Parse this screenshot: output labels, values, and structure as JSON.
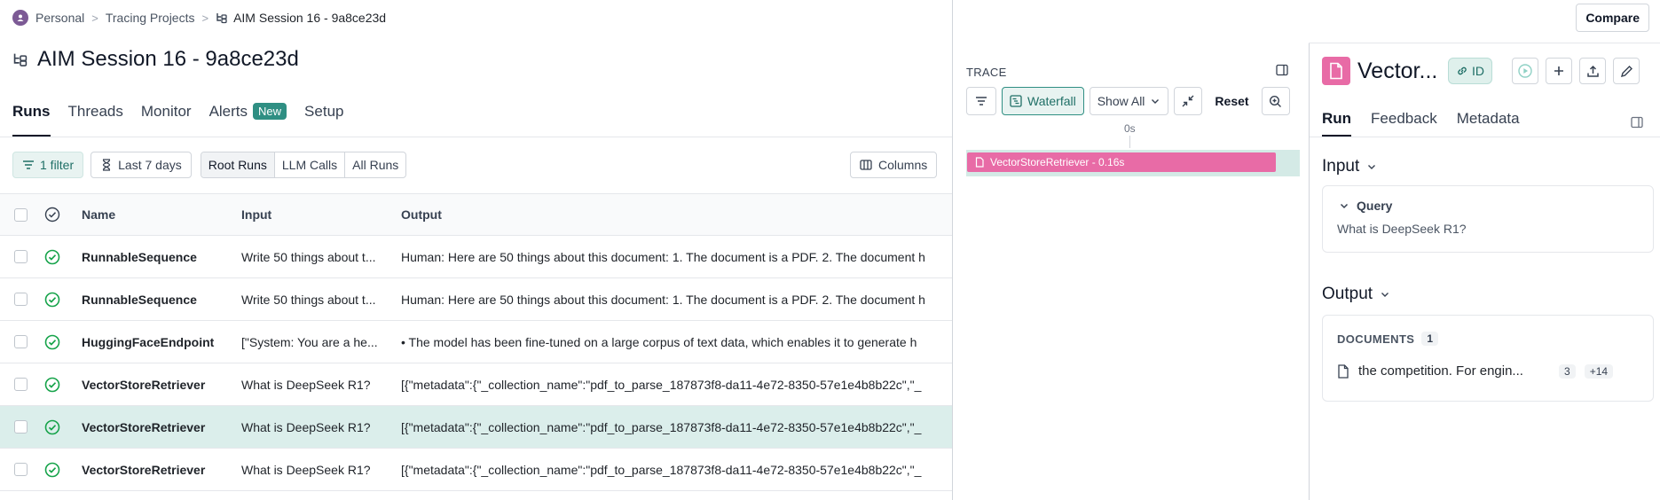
{
  "breadcrumb": {
    "workspace": "Personal",
    "projects": "Tracing Projects",
    "session": "AIM Session 16 - 9a8ce23d"
  },
  "page": {
    "title": "AIM Session 16 - 9a8ce23d"
  },
  "tabs": [
    {
      "label": "Runs"
    },
    {
      "label": "Threads"
    },
    {
      "label": "Monitor"
    },
    {
      "label": "Alerts",
      "badge": "New"
    },
    {
      "label": "Setup"
    }
  ],
  "filters": {
    "filter_label": "1 filter",
    "date_label": "Last 7 days",
    "run_types": [
      "Root Runs",
      "LLM Calls",
      "All Runs"
    ],
    "columns_label": "Columns"
  },
  "table": {
    "headers": {
      "name": "Name",
      "input": "Input",
      "output": "Output"
    },
    "rows": [
      {
        "name": "RunnableSequence",
        "input": "Write 50 things about t...",
        "output": "Human: Here are 50 things about this document: 1. The document is a PDF. 2. The document h"
      },
      {
        "name": "RunnableSequence",
        "input": "Write 50 things about t...",
        "output": "Human: Here are 50 things about this document: 1. The document is a PDF. 2. The document h"
      },
      {
        "name": "HuggingFaceEndpoint",
        "input": "[\"System: You are a he...",
        "output": "• The model has been fine-tuned on a large corpus of text data, which enables it to generate h"
      },
      {
        "name": "VectorStoreRetriever",
        "input": "What is DeepSeek R1?",
        "output": "[{\"metadata\":{\"_collection_name\":\"pdf_to_parse_187873f8-da11-4e72-8350-57e1e4b8b22c\",\"_"
      },
      {
        "name": "VectorStoreRetriever",
        "input": "What is DeepSeek R1?",
        "output": "[{\"metadata\":{\"_collection_name\":\"pdf_to_parse_187873f8-da11-4e72-8350-57e1e4b8b22c\",\"_"
      },
      {
        "name": "VectorStoreRetriever",
        "input": "What is DeepSeek R1?",
        "output": "[{\"metadata\":{\"_collection_name\":\"pdf_to_parse_187873f8-da11-4e72-8350-57e1e4b8b22c\",\"_"
      }
    ]
  },
  "topbar": {
    "compare_label": "Compare"
  },
  "trace": {
    "label": "TRACE",
    "waterfall_label": "Waterfall",
    "show_all_label": "Show All",
    "reset_label": "Reset",
    "time_label": "0s",
    "run_bar_label": "VectorStoreRetriever - 0.16s"
  },
  "detail": {
    "title": "Vector...",
    "id_label": "ID",
    "tabs": [
      "Run",
      "Feedback",
      "Metadata"
    ],
    "input_heading": "Input",
    "query_label": "Query",
    "query_value": "What is DeepSeek R1?",
    "output_heading": "Output",
    "documents_label": "DOCUMENTS",
    "documents_count": "1",
    "doc_text": "the competition. For engin...",
    "doc_num": "3",
    "doc_more": "+14"
  },
  "colors": {
    "accent": "#2f8f83",
    "retriever": "#e86ba6",
    "selected_row": "#dbeeeb"
  }
}
